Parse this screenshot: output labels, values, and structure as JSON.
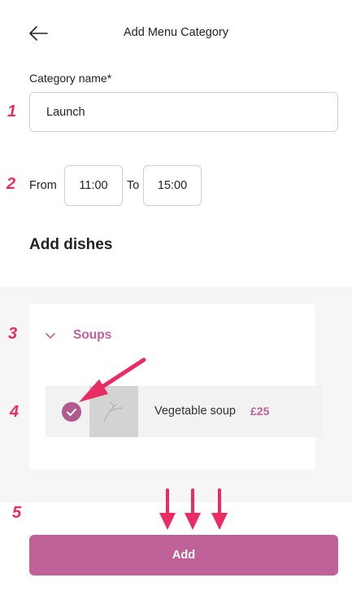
{
  "header": {
    "title": "Add Menu Category",
    "back_icon": "arrow-left-icon"
  },
  "form": {
    "category_label": "Category name*",
    "category_value": "Launch",
    "from_label": "From",
    "from_value": "11:00",
    "to_label": "To",
    "to_value": "15:00"
  },
  "dishes": {
    "section_title": "Add dishes",
    "category": {
      "name": "Soups",
      "expanded": true,
      "items": [
        {
          "name": "Vegetable soup",
          "price": "£25",
          "checked": true
        }
      ]
    }
  },
  "actions": {
    "add_label": "Add"
  },
  "annotations": {
    "steps": [
      "1",
      "2",
      "3",
      "4",
      "5"
    ]
  },
  "colors": {
    "accent": "#c0619a",
    "check_fill": "#b05a90",
    "annotation": "#ea2c64",
    "panel_bg": "#f6f6f6",
    "border": "#cfcfcf"
  }
}
